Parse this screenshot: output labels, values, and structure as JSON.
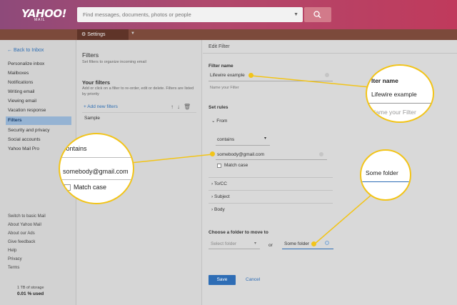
{
  "header": {
    "logo": "YAHOO!",
    "logo_sub": "MAIL",
    "search_placeholder": "Find messages, documents, photos or people"
  },
  "tabbar": {
    "settings_tab": "Settings"
  },
  "leftnav": {
    "back": "Back to Inbox",
    "items": [
      "Personalize inbox",
      "Mailboxes",
      "Notifications",
      "Writing email",
      "Viewing email",
      "Vacation response",
      "Filters",
      "Security and privacy",
      "Social accounts",
      "Yahoo Mail Pro"
    ],
    "active_index": 6,
    "footer_links": [
      "Switch to basic Mail",
      "About Yahoo Mail",
      "About our Ads",
      "Give feedback",
      "Help",
      "Privacy",
      "Terms"
    ],
    "storage_total": "1 TB of storage",
    "storage_used": "0.01 % used"
  },
  "filters_col": {
    "title": "Filters",
    "subtitle": "Set filters to organize incoming email",
    "your_filters": "Your filters",
    "description": "Add or click on a filter to re-order, edit or delete. Filters are listed by priority",
    "add_new": "Add new filters",
    "sample": "Sample"
  },
  "edit": {
    "title": "Edit Filter",
    "filter_name_label": "Filter name",
    "filter_name_value": "Lifewire example",
    "filter_name_hint": "Name your Filter",
    "set_rules": "Set rules",
    "from_label": "From",
    "contains_value": "contains",
    "email_value": "somebody@gmail.com",
    "match_case": "Match case",
    "to_cc": "To/CC",
    "subject": "Subject",
    "body": "Body",
    "choose_folder": "Choose a folder to move to",
    "select_folder_placeholder": "Select folder",
    "or": "or",
    "new_folder_value": "Some folder",
    "save": "Save",
    "cancel": "Cancel"
  },
  "callouts": {
    "filter_name": {
      "label": "lter name",
      "value": "Lifewire example",
      "hint": "Name your Filter"
    },
    "email": {
      "contains": "contains",
      "email": "somebody@gmail.com",
      "match_case": "Match case"
    },
    "folder": {
      "value": "Some folder"
    }
  },
  "colors": {
    "accent": "#f2c419",
    "link": "#2f6fb3",
    "save": "#2e6db5",
    "active_nav": "#95b3d3"
  },
  "icons": [
    "search-icon",
    "gear-icon",
    "chevron-down-icon",
    "back-arrow-icon",
    "plus-icon",
    "arrow-up-icon",
    "arrow-down-icon",
    "trash-icon",
    "chevron-right-icon",
    "clear-icon"
  ]
}
